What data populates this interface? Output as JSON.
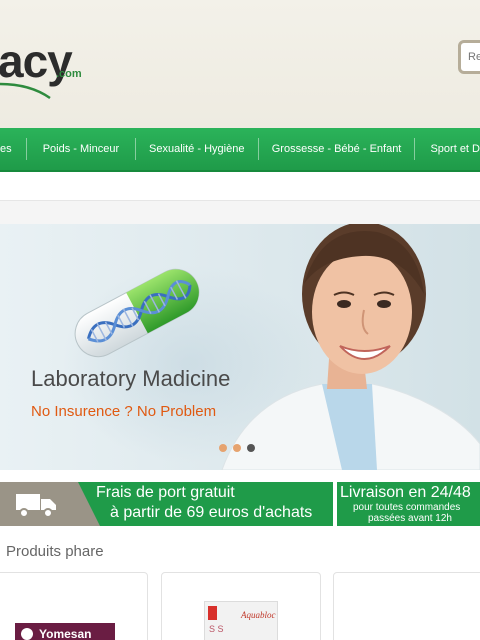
{
  "header": {
    "logo_text": "acy",
    "logo_suffix": ".com",
    "search_placeholder": "Re"
  },
  "nav": {
    "items": [
      "es",
      "Poids - Minceur",
      "Sexualité - Hygiène",
      "Grossesse - Bébé - Enfant",
      "Sport et D"
    ]
  },
  "banner": {
    "title": "Laboratory Madicine",
    "subtitle": "No Insurence ? No Problem",
    "slides_count": 3,
    "active_slide": 3
  },
  "shipping": {
    "free_line1": "Frais de port gratuit",
    "free_line2": "à partir de 69 euros d'achats",
    "delivery_title": "Livraison en 24/48",
    "delivery_sub1": "pour toutes commandes",
    "delivery_sub2": "passées avant 12h"
  },
  "products": {
    "section_title": "Produits phare",
    "items": [
      {
        "brand": "Yomesan"
      },
      {
        "brand": "Aquabloc"
      },
      {
        "brand": ""
      }
    ]
  },
  "colors": {
    "brand_green": "#1f9b49",
    "accent_orange": "#e05a12",
    "header_bg": "#f3f1e9"
  }
}
